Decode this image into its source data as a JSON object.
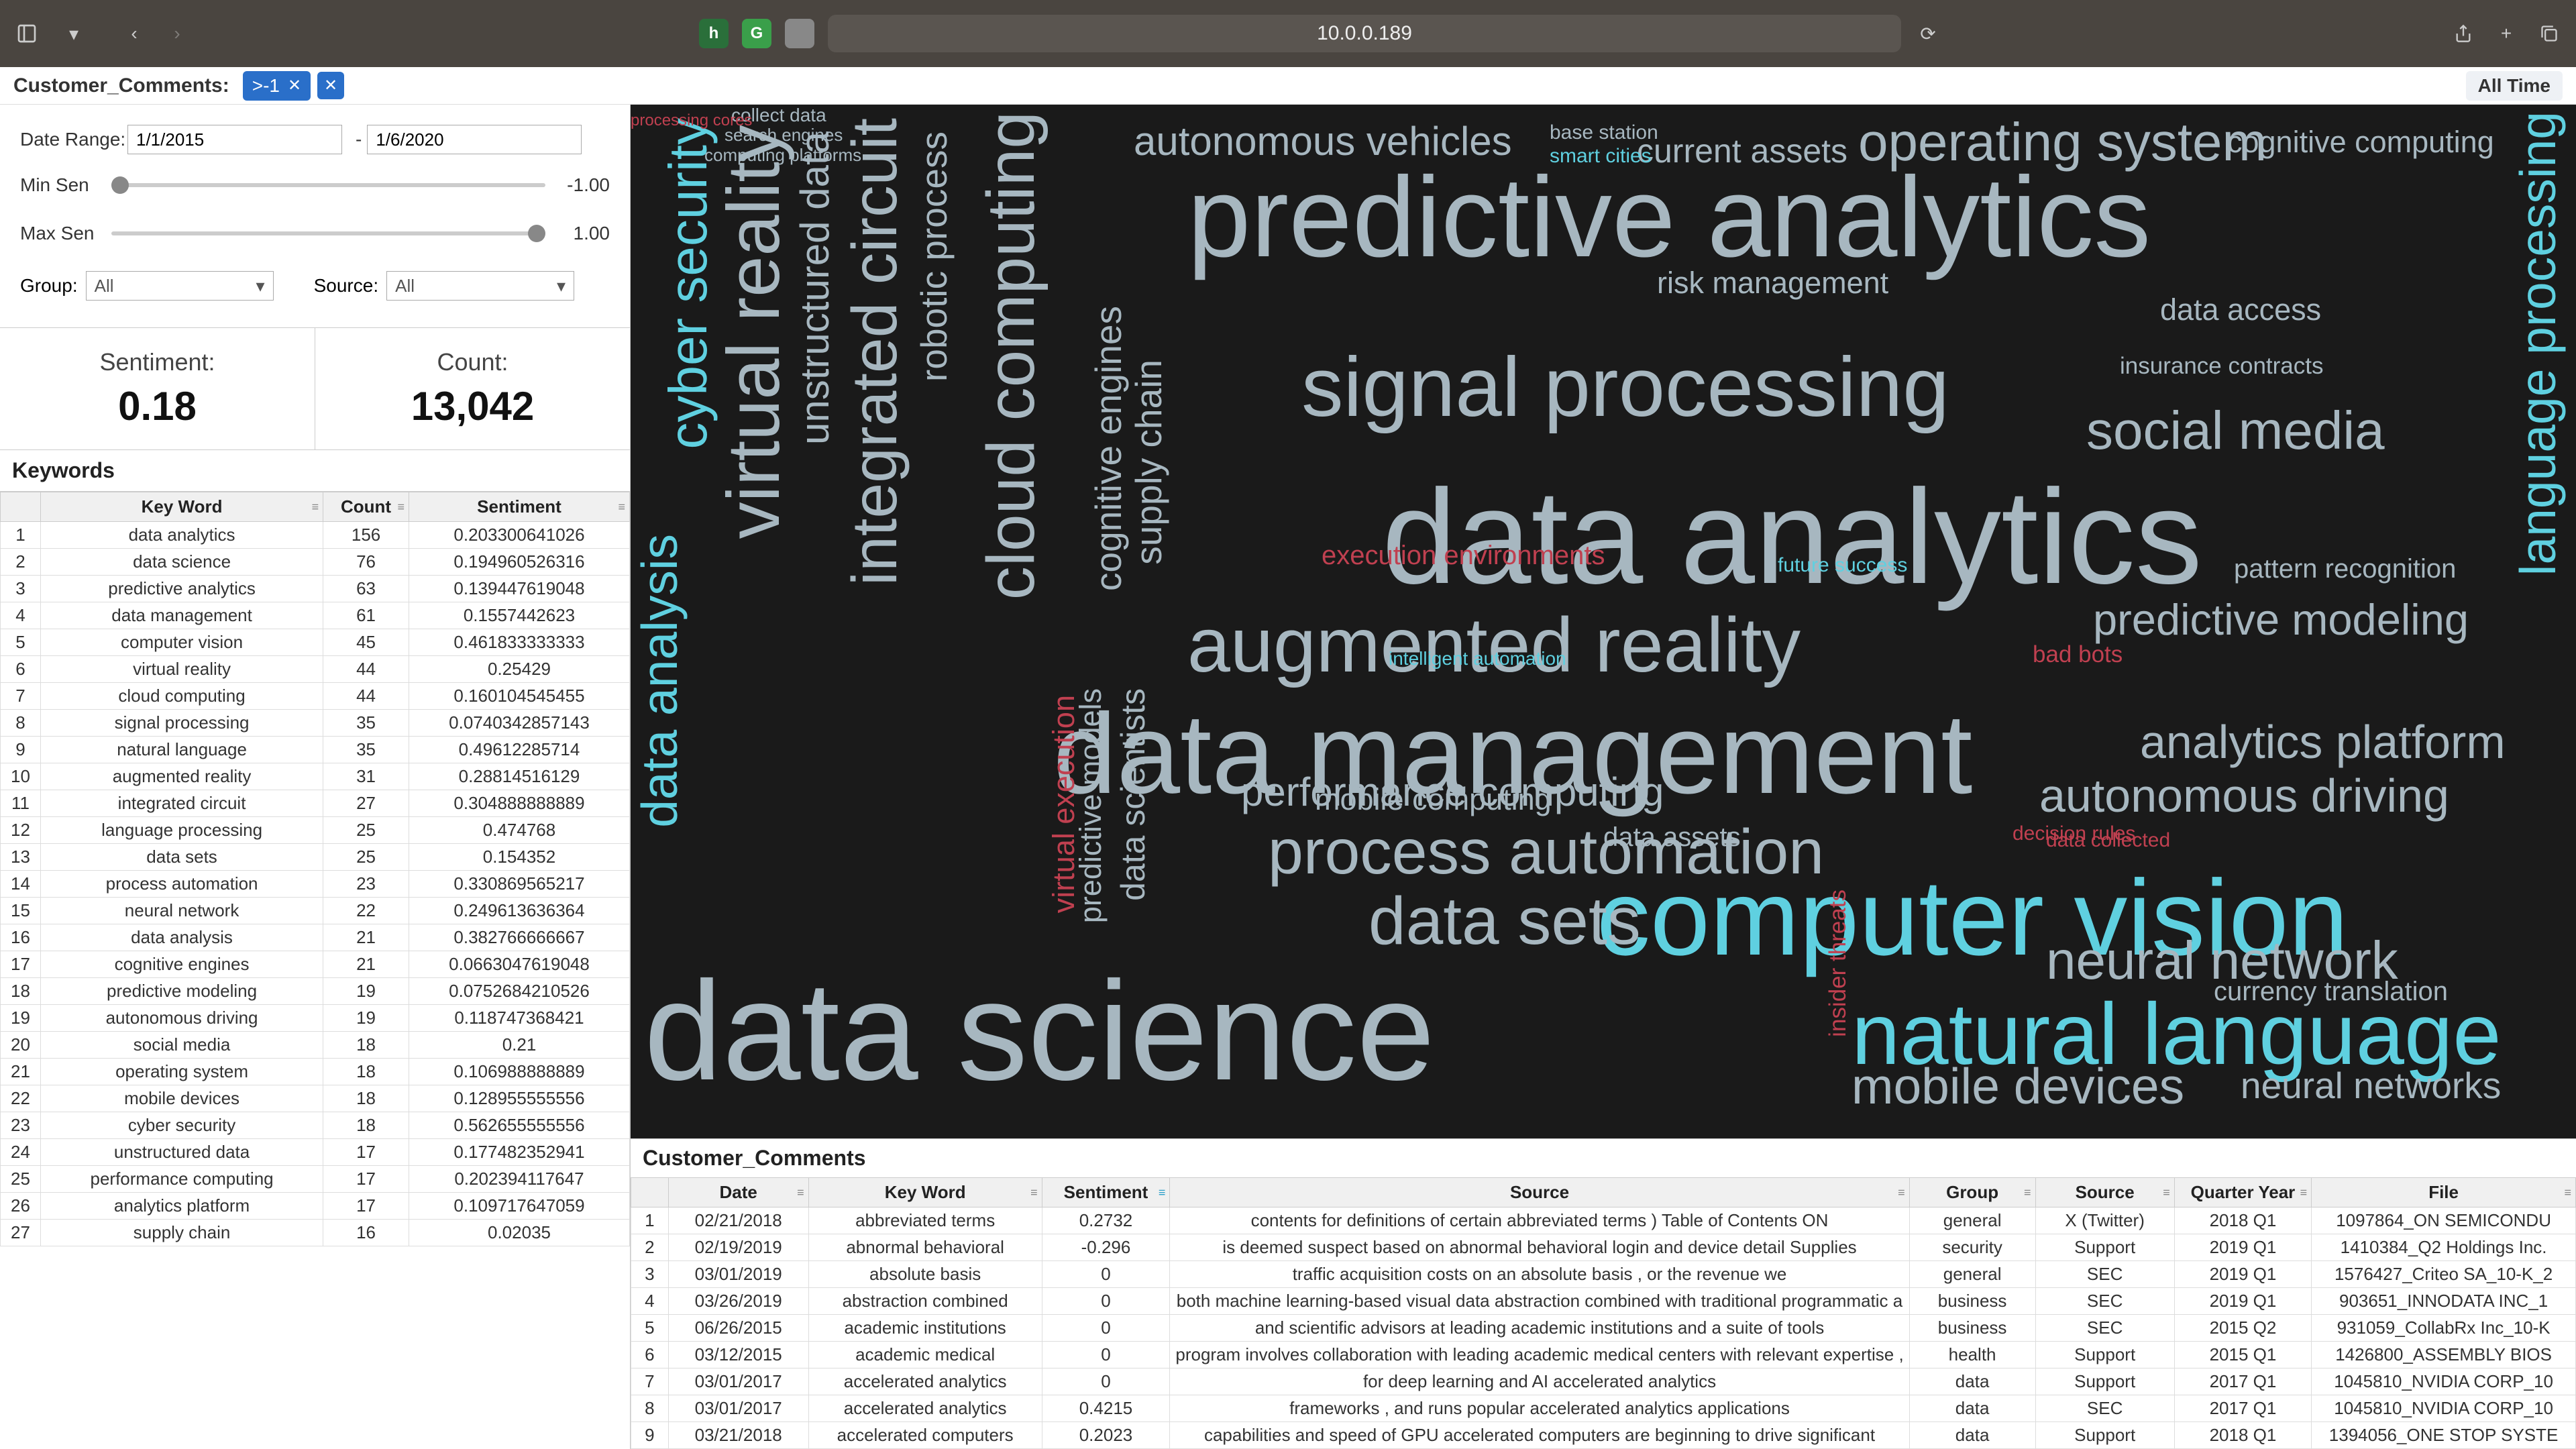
{
  "chrome": {
    "url": "10.0.0.189",
    "ext_h": "h",
    "ext_g": "G"
  },
  "breadcrumb": {
    "title": "Customer_Comments:",
    "chip1": ">-1",
    "chip_x": "✕",
    "alltime": "All Time"
  },
  "filters": {
    "daterange_label": "Date Range:",
    "date_from": "1/1/2015",
    "date_to": "1/6/2020",
    "dash": "-",
    "min_sen_label": "Min Sen",
    "min_sen_val": "-1.00",
    "max_sen_label": "Max Sen",
    "max_sen_val": "1.00",
    "group_label": "Group:",
    "group_val": "All",
    "source_label": "Source:",
    "source_val": "All"
  },
  "stats": {
    "sentiment_label": "Sentiment:",
    "sentiment_value": "0.18",
    "count_label": "Count:",
    "count_value": "13,042"
  },
  "keywords": {
    "title": "Keywords",
    "headers": {
      "kw": "Key Word",
      "count": "Count",
      "sent": "Sentiment"
    },
    "rows": [
      {
        "i": "1",
        "kw": "data analytics",
        "c": "156",
        "s": "0.203300641026"
      },
      {
        "i": "2",
        "kw": "data science",
        "c": "76",
        "s": "0.194960526316"
      },
      {
        "i": "3",
        "kw": "predictive analytics",
        "c": "63",
        "s": "0.139447619048"
      },
      {
        "i": "4",
        "kw": "data management",
        "c": "61",
        "s": "0.1557442623"
      },
      {
        "i": "5",
        "kw": "computer vision",
        "c": "45",
        "s": "0.461833333333"
      },
      {
        "i": "6",
        "kw": "virtual reality",
        "c": "44",
        "s": "0.25429"
      },
      {
        "i": "7",
        "kw": "cloud computing",
        "c": "44",
        "s": "0.160104545455"
      },
      {
        "i": "8",
        "kw": "signal processing",
        "c": "35",
        "s": "0.0740342857143"
      },
      {
        "i": "9",
        "kw": "natural language",
        "c": "35",
        "s": "0.49612285714"
      },
      {
        "i": "10",
        "kw": "augmented reality",
        "c": "31",
        "s": "0.28814516129"
      },
      {
        "i": "11",
        "kw": "integrated circuit",
        "c": "27",
        "s": "0.304888888889"
      },
      {
        "i": "12",
        "kw": "language processing",
        "c": "25",
        "s": "0.474768"
      },
      {
        "i": "13",
        "kw": "data sets",
        "c": "25",
        "s": "0.154352"
      },
      {
        "i": "14",
        "kw": "process automation",
        "c": "23",
        "s": "0.330869565217"
      },
      {
        "i": "15",
        "kw": "neural network",
        "c": "22",
        "s": "0.249613636364"
      },
      {
        "i": "16",
        "kw": "data analysis",
        "c": "21",
        "s": "0.382766666667"
      },
      {
        "i": "17",
        "kw": "cognitive engines",
        "c": "21",
        "s": "0.0663047619048"
      },
      {
        "i": "18",
        "kw": "predictive modeling",
        "c": "19",
        "s": "0.0752684210526"
      },
      {
        "i": "19",
        "kw": "autonomous driving",
        "c": "19",
        "s": "0.118747368421"
      },
      {
        "i": "20",
        "kw": "social media",
        "c": "18",
        "s": "0.21"
      },
      {
        "i": "21",
        "kw": "operating system",
        "c": "18",
        "s": "0.106988888889"
      },
      {
        "i": "22",
        "kw": "mobile devices",
        "c": "18",
        "s": "0.128955555556"
      },
      {
        "i": "23",
        "kw": "cyber security",
        "c": "18",
        "s": "0.562655555556"
      },
      {
        "i": "24",
        "kw": "unstructured data",
        "c": "17",
        "s": "0.177482352941"
      },
      {
        "i": "25",
        "kw": "performance computing",
        "c": "17",
        "s": "0.202394117647"
      },
      {
        "i": "26",
        "kw": "analytics platform",
        "c": "17",
        "s": "0.109717647059"
      },
      {
        "i": "27",
        "kw": "supply chain",
        "c": "16",
        "s": "0.02035"
      }
    ]
  },
  "comments": {
    "title": "Customer_Comments",
    "headers": {
      "date": "Date",
      "kw": "Key Word",
      "sent": "Sentiment",
      "src": "Source",
      "grp": "Group",
      "srcn": "Source",
      "qy": "Quarter Year",
      "file": "File"
    },
    "rows": [
      {
        "i": "1",
        "d": "02/21/2018",
        "k": "abbreviated terms",
        "s": "0.2732",
        "src": "contents for definitions of certain abbreviated terms ) Table of Contents ON",
        "g": "general",
        "sn": "X (Twitter)",
        "q": "2018 Q1",
        "f": "1097864_ON SEMICONDU"
      },
      {
        "i": "2",
        "d": "02/19/2019",
        "k": "abnormal behavioral",
        "s": "-0.296",
        "src": "is deemed suspect based on abnormal behavioral login and device detail Supplies",
        "g": "security",
        "sn": "Support",
        "q": "2019 Q1",
        "f": "1410384_Q2 Holdings Inc."
      },
      {
        "i": "3",
        "d": "03/01/2019",
        "k": "absolute basis",
        "s": "0",
        "src": "traffic acquisition costs on an absolute basis , or the revenue we",
        "g": "general",
        "sn": "SEC",
        "q": "2019 Q1",
        "f": "1576427_Criteo SA_10-K_2"
      },
      {
        "i": "4",
        "d": "03/26/2019",
        "k": "abstraction combined",
        "s": "0",
        "src": "both machine learning-based visual data abstraction combined with traditional programmatic a",
        "g": "business",
        "sn": "SEC",
        "q": "2019 Q1",
        "f": "903651_INNODATA INC_1"
      },
      {
        "i": "5",
        "d": "06/26/2015",
        "k": "academic institutions",
        "s": "0",
        "src": "and scientific advisors at leading academic institutions and a suite of tools",
        "g": "business",
        "sn": "SEC",
        "q": "2015 Q2",
        "f": "931059_CollabRx Inc_10-K"
      },
      {
        "i": "6",
        "d": "03/12/2015",
        "k": "academic medical",
        "s": "0",
        "src": "program involves collaboration with leading academic medical centers with relevant expertise ,",
        "g": "health",
        "sn": "Support",
        "q": "2015 Q1",
        "f": "1426800_ASSEMBLY BIOS"
      },
      {
        "i": "7",
        "d": "03/01/2017",
        "k": "accelerated analytics",
        "s": "0",
        "src": "for deep learning and AI accelerated analytics",
        "g": "data",
        "sn": "Support",
        "q": "2017 Q1",
        "f": "1045810_NVIDIA CORP_10"
      },
      {
        "i": "8",
        "d": "03/01/2017",
        "k": "accelerated analytics",
        "s": "0.4215",
        "src": "frameworks , and runs popular accelerated analytics applications",
        "g": "data",
        "sn": "SEC",
        "q": "2017 Q1",
        "f": "1045810_NVIDIA CORP_10"
      },
      {
        "i": "9",
        "d": "03/21/2018",
        "k": "accelerated computers",
        "s": "0.2023",
        "src": "capabilities and speed of GPU accelerated computers are beginning to drive significant",
        "g": "data",
        "sn": "Support",
        "q": "2018 Q1",
        "f": "1394056_ONE STOP SYSTE"
      }
    ]
  },
  "wc": {
    "w1": "predictive analytics",
    "w2": "data analytics",
    "w3": "data management",
    "w4": "data science",
    "w5": "computer vision",
    "w6": "natural language",
    "w7": "signal processing",
    "w8": "augmented reality",
    "w9": "process automation",
    "w10": "data sets",
    "w11": "operating system",
    "w12": "social media",
    "w13": "neural network",
    "w14": "mobile devices",
    "w15": "analytics platform",
    "w16": "autonomous driving",
    "w17": "predictive modeling",
    "w18": "cognitive computing",
    "w19": "autonomous vehicles",
    "w20": "performance computing",
    "w21": "cyber security",
    "w22": "virtual reality",
    "w23": "integrated circuit",
    "w24": "cloud computing",
    "w25": "data analysis",
    "w26": "language processing",
    "w27": "neural networks",
    "w28": "unstructured data",
    "w29": "robotic process",
    "w30": "supply chain",
    "w31": "cognitive engines",
    "w32": "data scientists",
    "w33": "predictive models",
    "w34": "mobile computing",
    "w35": "data assets",
    "w36": "risk management",
    "w37": "current assets",
    "w38": "data access",
    "w39": "currency translation",
    "w40": "pattern recognition",
    "w41": "execution environments",
    "w42": "virtual execution",
    "w43": "insider threats",
    "w44": "bad bots",
    "w45": "data collected",
    "w46": "decision rules",
    "w47": "future success",
    "w48": "intelligent automation",
    "w49": "smart cities",
    "w50": "base station",
    "w51": "collect data",
    "w52": "search engines",
    "w53": "computing platforms",
    "w54": "processing cores",
    "w55": "insurance contracts"
  }
}
